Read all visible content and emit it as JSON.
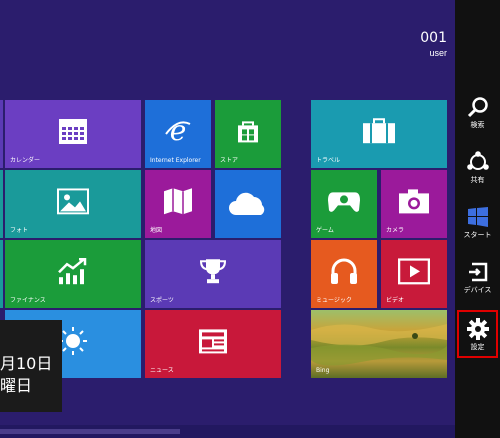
{
  "user": {
    "number": "001",
    "name": "user"
  },
  "tiles": {
    "calendar": "カレンダー",
    "ie": "Internet Explorer",
    "store": "ストア",
    "travel": "トラベル",
    "photos": "フォト",
    "maps": "地図",
    "games": "ゲーム",
    "camera": "カメラ",
    "finance": "ファイナンス",
    "sports": "スポーツ",
    "music": "ミュージック",
    "video": "ビデオ",
    "news": "ニュース",
    "bing": "Bing"
  },
  "clock": {
    "line1": "月10日",
    "line2": "曜日"
  },
  "charms": [
    {
      "label": "検索"
    },
    {
      "label": "共有"
    },
    {
      "label": "スタート"
    },
    {
      "label": "デバイス"
    },
    {
      "label": "設定"
    }
  ],
  "colors": {
    "background": "#2b1d6d",
    "charm_bar": "#111111",
    "selected_border": "#e00000"
  }
}
